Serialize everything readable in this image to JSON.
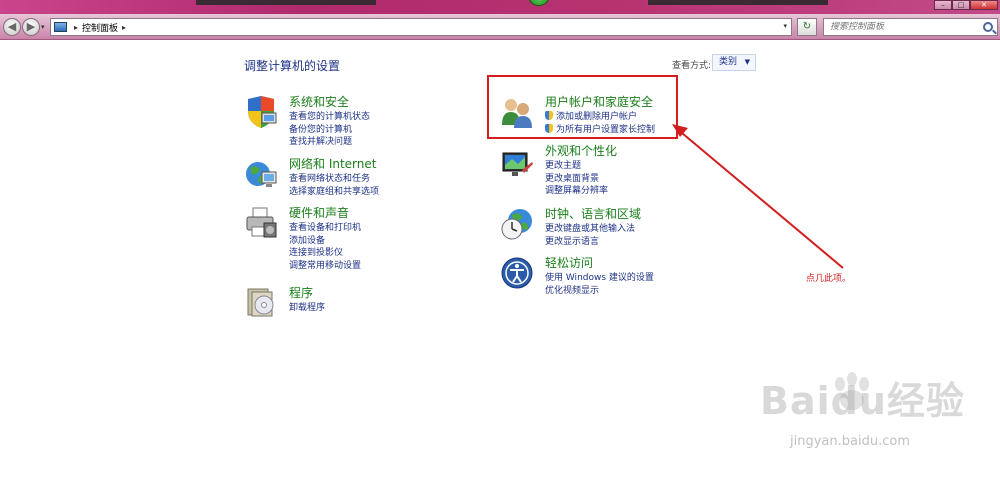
{
  "window": {
    "controls": [
      "–",
      "□",
      "✕"
    ]
  },
  "addressbar": {
    "back_glyph": "◀",
    "forward_glyph": "▶",
    "history_glyph": "▾",
    "separator": "▸",
    "location": "控制面板",
    "refresh_glyph": "↻",
    "search_placeholder": "搜索控制面板"
  },
  "main": {
    "title": "调整计算机的设置",
    "view_by_label": "查看方式:",
    "view_by_value": "类别"
  },
  "categories_left": [
    {
      "title": "系统和安全",
      "links": [
        "查看您的计算机状态",
        "备份您的计算机",
        "查找并解决问题"
      ],
      "icon": "shield-computer-icon"
    },
    {
      "title": "网络和 Internet",
      "links": [
        "查看网络状态和任务",
        "选择家庭组和共享选项"
      ],
      "icon": "network-globe-icon"
    },
    {
      "title": "硬件和声音",
      "links": [
        "查看设备和打印机",
        "添加设备",
        "连接到投影仪",
        "调整常用移动设置"
      ],
      "icon": "printer-icon"
    },
    {
      "title": "程序",
      "links": [
        "卸载程序"
      ],
      "icon": "programs-disc-icon"
    }
  ],
  "categories_right": [
    {
      "title": "用户帐户和家庭安全",
      "links": [
        "添加或删除用户帐户",
        "为所有用户设置家长控制"
      ],
      "icon": "user-accounts-icon"
    },
    {
      "title": "外观和个性化",
      "links": [
        "更改主题",
        "更改桌面背景",
        "调整屏幕分辨率"
      ],
      "icon": "appearance-monitor-icon"
    },
    {
      "title": "时钟、语言和区域",
      "links": [
        "更改键盘或其他输入法",
        "更改显示语言"
      ],
      "icon": "clock-globe-icon"
    },
    {
      "title": "轻松访问",
      "links": [
        "使用 Windows 建议的设置",
        "优化视频显示"
      ],
      "icon": "ease-of-access-icon"
    }
  ],
  "annotation": {
    "text": "点几此项。",
    "color": "#d21e1e"
  },
  "watermark": {
    "logo": "Baidu经验",
    "url": "jingyan.baidu.com"
  },
  "colors": {
    "title_bar": "#b02a6e",
    "category_title": "#1a7e1a",
    "link": "#1e3287",
    "highlight": "#d21e1e"
  }
}
